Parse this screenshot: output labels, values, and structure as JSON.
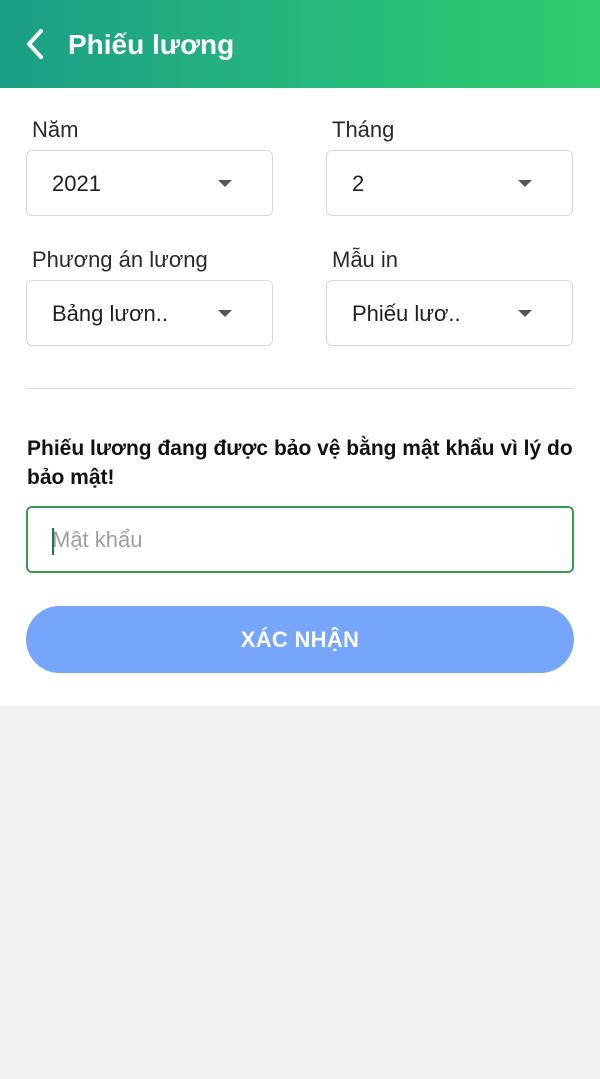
{
  "header": {
    "title": "Phiếu lương",
    "back_icon": "chevron-left-icon",
    "gradient_start": "#1a9e86",
    "gradient_end": "#2fcb6c"
  },
  "filters": {
    "year": {
      "label": "Năm",
      "value": "2021"
    },
    "month": {
      "label": "Tháng",
      "value": "2"
    },
    "salary_plan": {
      "label": "Phương án lương",
      "value": "Bảng lươn.."
    },
    "print_template": {
      "label": "Mẫu in",
      "value": "Phiếu lươ.."
    }
  },
  "notice": "Phiếu lương đang được bảo vệ bằng mật khẩu vì lý do bảo mật!",
  "password": {
    "placeholder": "Mật khẩu",
    "value": ""
  },
  "confirm_button": {
    "label": "XÁC NHẬN",
    "color": "#75a6fb"
  }
}
